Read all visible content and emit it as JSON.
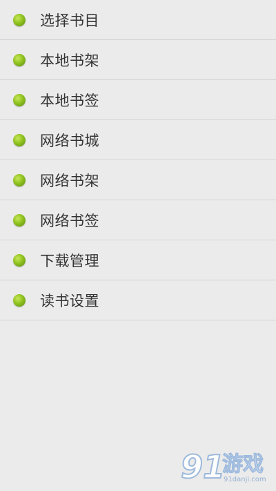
{
  "menu": {
    "items": [
      {
        "label": "选择书目"
      },
      {
        "label": "本地书架"
      },
      {
        "label": "本地书签"
      },
      {
        "label": "网络书城"
      },
      {
        "label": "网络书架"
      },
      {
        "label": "网络书签"
      },
      {
        "label": "下载管理"
      },
      {
        "label": "读书设置"
      }
    ]
  },
  "watermark": {
    "number": "91",
    "text": "游戏",
    "site": "91danji.com"
  },
  "colors": {
    "background": "#ebebeb",
    "divider": "#d3d3d3",
    "bullet": "#8fc21f",
    "text": "#333333"
  }
}
